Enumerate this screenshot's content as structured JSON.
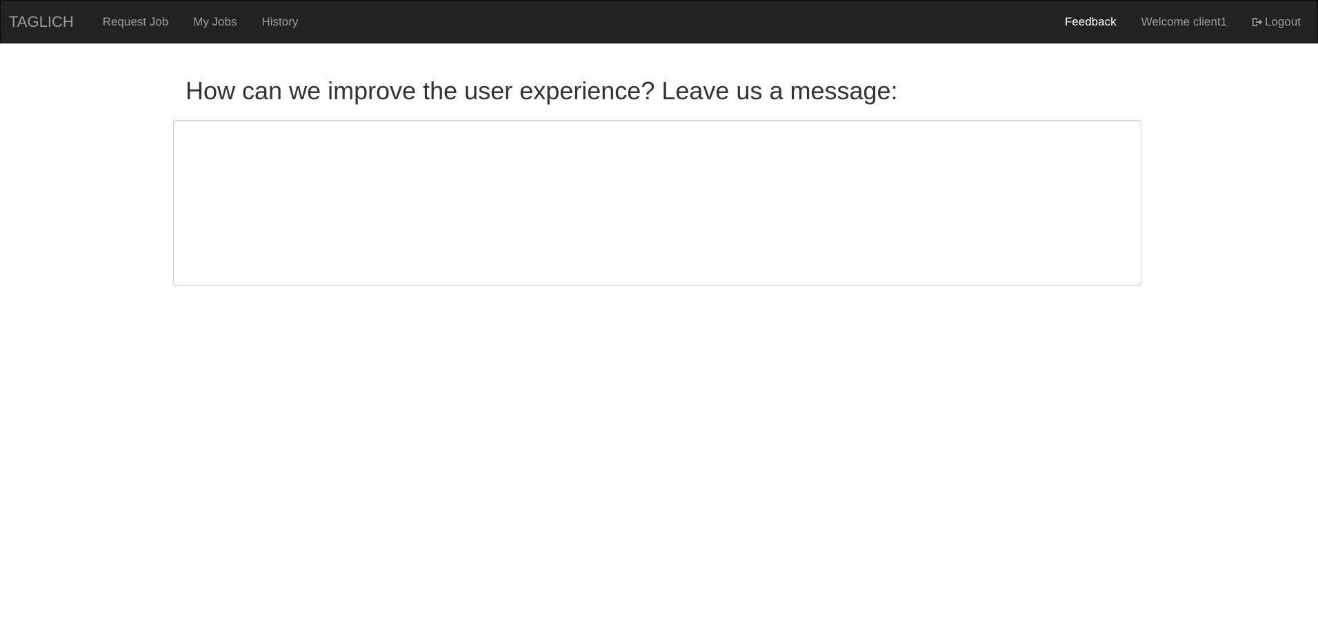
{
  "navbar": {
    "brand": "TAGLICH",
    "links": [
      {
        "label": "Request Job"
      },
      {
        "label": "My Jobs"
      },
      {
        "label": "History"
      }
    ],
    "right": {
      "feedback": "Feedback",
      "welcome": "Welcome client1",
      "logout": "Logout",
      "logout_icon": "logout-icon"
    }
  },
  "main": {
    "heading": "How can we improve the user experience? Leave us a message:",
    "message_value": "",
    "message_placeholder": ""
  },
  "colors": {
    "navbar_bg": "#222222",
    "nav_text": "#9d9d9d",
    "nav_active": "#ffffff",
    "heading_text": "#333333",
    "input_border": "#cccccc"
  }
}
